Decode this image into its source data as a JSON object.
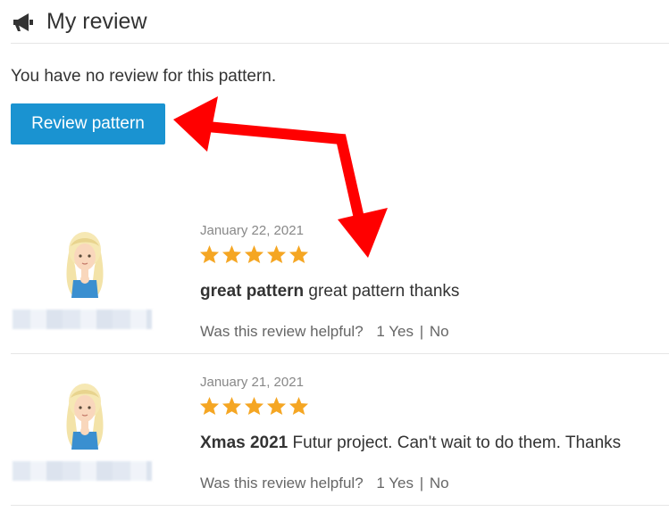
{
  "header": {
    "title": "My review",
    "icon": "megaphone-icon"
  },
  "no_review_text": "You have no review for this pattern.",
  "review_button_label": "Review pattern",
  "colors": {
    "button": "#1a93d1",
    "star": "#f5a623",
    "arrow": "#ff0000"
  },
  "reviews": [
    {
      "date": "January 22, 2021",
      "rating": 5,
      "title": "great pattern",
      "body": "great pattern thanks",
      "helpful_label": "Was this review helpful?",
      "yes_label": "1 Yes",
      "separator": "|",
      "no_label": "No"
    },
    {
      "date": "January 21, 2021",
      "rating": 5,
      "title": "Xmas 2021",
      "body": "Futur project. Can't wait to do them. Thanks",
      "helpful_label": "Was this review helpful?",
      "yes_label": "1 Yes",
      "separator": "|",
      "no_label": "No"
    }
  ]
}
